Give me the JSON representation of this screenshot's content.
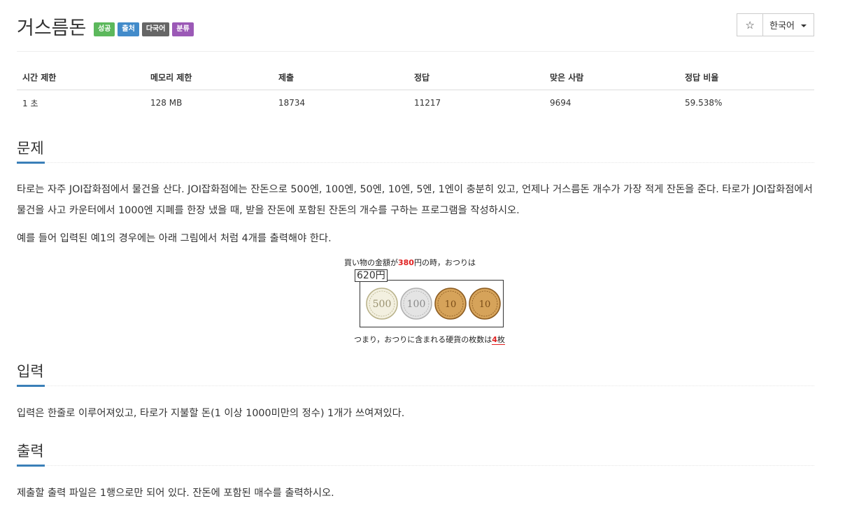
{
  "problem": {
    "title": "거스름돈",
    "labels": [
      {
        "text": "성공",
        "color": "#5cb85c"
      },
      {
        "text": "출처",
        "color": "#428bca"
      },
      {
        "text": "다국어",
        "color": "#666666"
      },
      {
        "text": "분류",
        "color": "#9b59b6"
      }
    ],
    "star_icon": "star-outline-icon",
    "language": "한국어"
  },
  "info_table": {
    "headers": [
      "시간 제한",
      "메모리 제한",
      "제출",
      "정답",
      "맞은 사람",
      "정답 비율"
    ],
    "row": [
      "1 초",
      "128 MB",
      "18734",
      "11217",
      "9694",
      "59.538%"
    ]
  },
  "sections": {
    "problem_heading": "문제",
    "problem_text_1": "타로는 자주 JOI잡화점에서 물건을 산다. JOI잡화점에는 잔돈으로 500엔, 100엔, 50엔, 10엔, 5엔, 1엔이 충분히 있고, 언제나 거스름돈 개수가 가장 적게 잔돈을 준다. 타로가 JOI잡화점에서 물건을 사고 카운터에서 1000엔 지폐를 한장 냈을 때, 받을 잔돈에 포함된 잔돈의 개수를 구하는 프로그램을 작성하시오.",
    "problem_text_2": "예를 들어 입력된 예1의 경우에는 아래 그림에서 처럼 4개를 출력해야 한다.",
    "input_heading": "입력",
    "input_text": "입력은 한줄로 이루어져있고, 타로가 지불할 돈(1 이상 1000미만의 정수) 1개가 쓰여져있다.",
    "output_heading": "출력",
    "output_text": "제출할 출력 파일은 1행으로만 되어 있다. 잔돈에 포함된 매수를 출력하시오."
  },
  "figure": {
    "top_prefix": "買い物の金額が",
    "top_amount": "380",
    "top_suffix": "円の時，おつりは",
    "change_amount": "620円",
    "coins": [
      {
        "value": "500",
        "face": "#f3f0e0",
        "rim": "#b9b28a",
        "text": "#9a9270"
      },
      {
        "value": "100",
        "face": "#e4e4e4",
        "rim": "#b0b0b0",
        "text": "#8a8a8a"
      },
      {
        "value": "10",
        "face": "#d6a35a",
        "rim": "#8a5a20",
        "text": "#7a4d18"
      },
      {
        "value": "10",
        "face": "#d6a35a",
        "rim": "#8a5a20",
        "text": "#7a4d18"
      }
    ],
    "bottom_prefix": "つまり，おつりに含まれる硬貨の枚数は",
    "bottom_count": "4",
    "bottom_suffix": "枚"
  }
}
